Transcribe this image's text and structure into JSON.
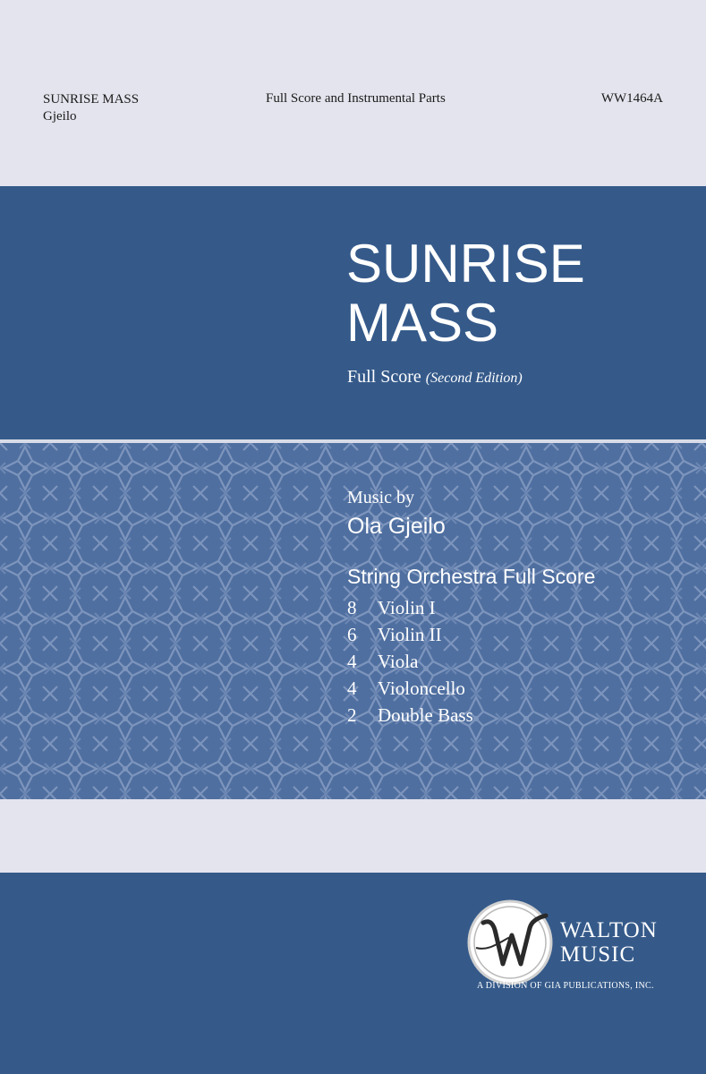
{
  "header": {
    "title": "SUNRISE MASS",
    "composer_short": "Gjeilo",
    "edition_type": "Full Score and Instrumental Parts",
    "catalog_number": "WW1464A"
  },
  "cover": {
    "title_line1": "SUNRISE",
    "title_line2": "MASS",
    "subtitle": "Full Score",
    "edition": "(Second Edition)"
  },
  "credits": {
    "music_by_label": "Music by",
    "composer": "Ola Gjeilo",
    "ensemble": "String Orchestra Full Score",
    "parts": [
      {
        "count": "8",
        "name": "Violin I"
      },
      {
        "count": "6",
        "name": "Violin II"
      },
      {
        "count": "4",
        "name": "Viola"
      },
      {
        "count": "4",
        "name": "Violoncello"
      },
      {
        "count": "2",
        "name": "Double Bass"
      }
    ]
  },
  "publisher": {
    "logo_line1": "WALTON",
    "logo_line2": "MUSIC",
    "tagline": "A DIVISION OF GIA PUBLICATIONS, INC.",
    "logo_icon": "walton-w-emblem"
  },
  "colors": {
    "band_blue": "#355a8a",
    "pattern_blue": "#4f6fa0",
    "light_gray": "#e4e4ee"
  }
}
